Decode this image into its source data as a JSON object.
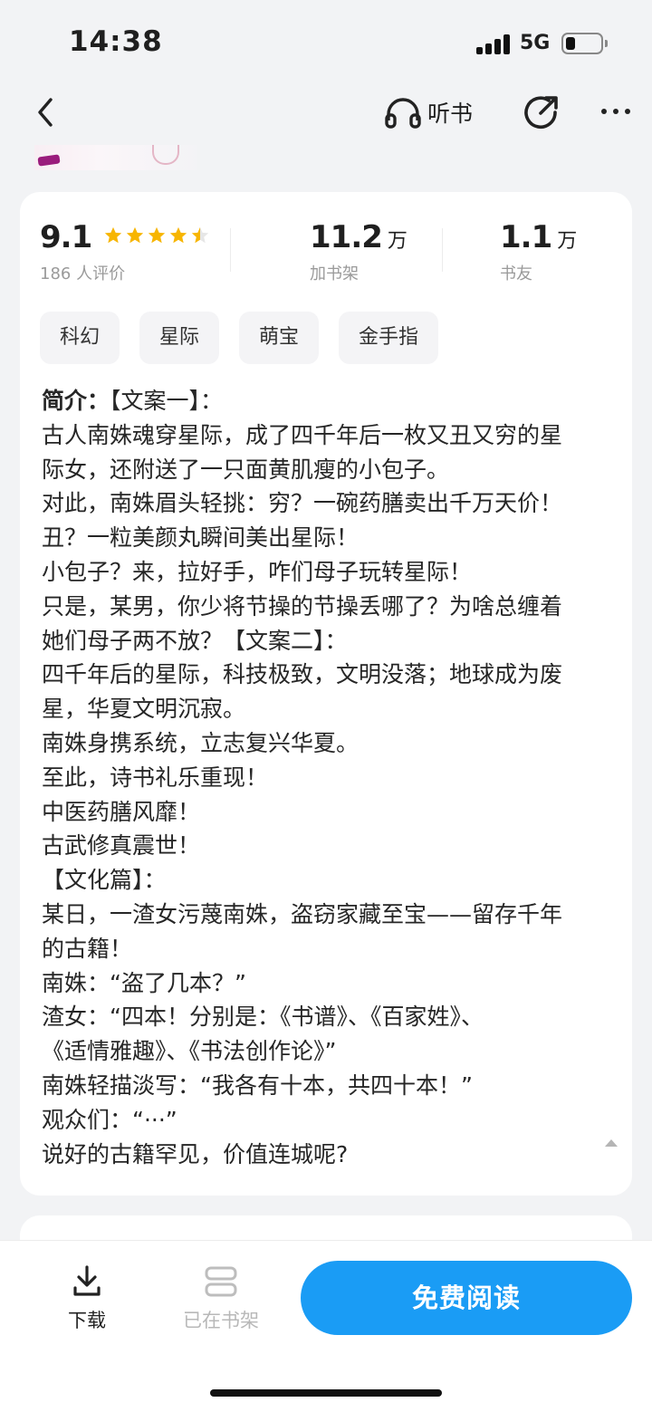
{
  "status_bar": {
    "time": "14:38",
    "network": "5G",
    "battery_level": 0.25
  },
  "nav": {
    "back_icon": "chevron-left-icon",
    "listen_label": "听书",
    "listen_icon": "headphones-icon",
    "share_icon": "share-icon",
    "more_icon": "more-dots-icon"
  },
  "stats": {
    "score": "9.1",
    "rating": 4.5,
    "rating_max": 5,
    "reviews": "186 人评价",
    "shelf_num": "11.2",
    "shelf_unit": "万",
    "shelf_label": "加书架",
    "friends_num": "1.1",
    "friends_unit": "万",
    "friends_label": "书友"
  },
  "tags": [
    "科幻",
    "星际",
    "萌宝",
    "金手指"
  ],
  "synopsis": {
    "lead": "简介：",
    "first_line_rest": "【文案一】：",
    "lines": [
      "古人南姝魂穿星际，成了四千年后一枚又丑又穷的星",
      "际女，还附送了一只面黄肌瘦的小包子。",
      "对此，南姝眉头轻挑：穷？一碗药膳卖出千万天价！",
      "丑？一粒美颜丸瞬间美出星际！",
      "小包子？来，拉好手，咋们母子玩转星际！",
      "只是，某男，你少将节操的节操丢哪了？为啥总缠着",
      "她们母子两不放？【文案二】：",
      "四千年后的星际，科技极致，文明没落；地球成为废",
      "星，华夏文明沉寂。",
      "南姝身携系统，立志复兴华夏。",
      "至此，诗书礼乐重现！",
      "中医药膳风靡！",
      "古武修真震世！",
      "【文化篇】：",
      "某日，一渣女污蔑南姝，盗窃家藏至宝——留存千年",
      "的古籍！",
      "南姝：“盗了几本？”",
      "渣女：“四本！分别是：《书谱》、《百家姓》、",
      "《适情雅趣》、《书法创作论》”",
      "南姝轻描淡写：“我各有十本，共四十本！”",
      "观众们：“···”",
      "说好的古籍罕见，价值连城呢?"
    ]
  },
  "bottom_bar": {
    "download_label": "下载",
    "shelf_label": "已在书架",
    "read_label": "免费阅读",
    "accent_color": "#1a9cf5"
  }
}
